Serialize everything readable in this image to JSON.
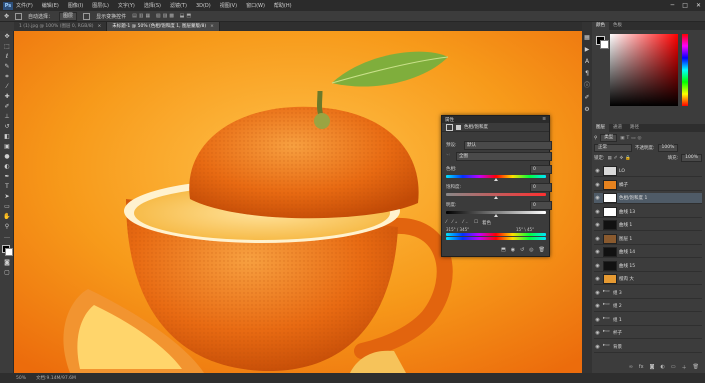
{
  "menubar": {
    "logo": "Ps",
    "items": [
      "文件(F)",
      "编辑(E)",
      "图像(I)",
      "图层(L)",
      "文字(Y)",
      "选择(S)",
      "滤镜(T)",
      "3D(D)",
      "视图(V)",
      "窗口(W)",
      "帮助(H)"
    ],
    "window_controls": [
      "─",
      "□",
      "✕"
    ]
  },
  "options": {
    "auto_select_label": "自动选择：",
    "auto_select_value": "图层",
    "transform_label": "显示变换控件"
  },
  "tabs": [
    {
      "label": "1 (1).jpg @ 100% (图层 0, RGB/8)",
      "active": false
    },
    {
      "label": "未标题-1 @ 50% (色相/饱和度 1, 图层蒙版/8)",
      "active": true
    }
  ],
  "status": {
    "zoom": "50%",
    "doc_size": "文档:9.14M/97.6M"
  },
  "panels": {
    "color_tabs": [
      "颜色",
      "色板"
    ],
    "layers_tabs": [
      "图层",
      "通道",
      "路径"
    ],
    "search_kind": "类型",
    "blend_mode": "正常",
    "opacity_label": "不透明度:",
    "opacity_value": "100%",
    "lock_label": "锁定:",
    "fill_label": "填充:",
    "fill_value": "100%"
  },
  "layers": [
    {
      "name": "LO",
      "thumb": "#d9d9d9",
      "selected": false
    },
    {
      "name": "橘子",
      "thumb": "#e6821e",
      "selected": false
    },
    {
      "name": "色相/饱和度 1",
      "thumb": "#ffffff",
      "selected": true
    },
    {
      "name": "曲线 13",
      "thumb": "#ffffff",
      "selected": false
    },
    {
      "name": "曲线 1",
      "thumb": "#111111",
      "selected": false
    },
    {
      "name": "图层 1",
      "thumb": "#8a5a2e",
      "selected": false
    },
    {
      "name": "曲线 14",
      "thumb": "#111111",
      "selected": false
    },
    {
      "name": "曲线 15",
      "thumb": "#111111",
      "selected": false
    },
    {
      "name": "橙肉 大",
      "thumb": "#e69a32",
      "selected": false
    },
    {
      "name": "组 3",
      "thumb": "",
      "selected": false
    },
    {
      "name": "组 2",
      "thumb": "",
      "selected": false
    },
    {
      "name": "组 1",
      "thumb": "",
      "selected": false
    },
    {
      "name": "杯子",
      "thumb": "",
      "selected": false
    },
    {
      "name": "背景",
      "thumb": "",
      "selected": false
    }
  ],
  "properties": {
    "header": "属性",
    "title": "色相/饱和度",
    "preset_label": "预设:",
    "preset_value": "默认",
    "channel_value": "全图",
    "hue_label": "色相:",
    "hue_value": "0",
    "saturation_label": "饱和度:",
    "saturation_value": "0",
    "lightness_label": "明度:",
    "lightness_value": "0",
    "colorize_label": "着色",
    "range_left": "315° / 345°",
    "range_right": "15° \\ 45°"
  },
  "colors": {
    "accent_orange": "#f39a1e",
    "selection_blue": "#4f5b67"
  }
}
